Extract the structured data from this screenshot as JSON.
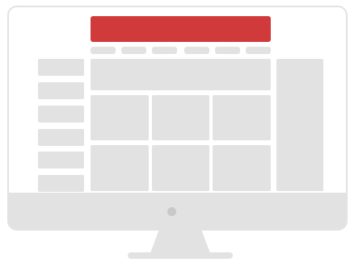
{
  "illustration": {
    "colors": {
      "accent": "#d03a3a",
      "placeholder": "#e2e2e2",
      "frame": "#e2e2e2",
      "power_dot": "#c8c8c8",
      "background": "#ffffff"
    },
    "nav_item_count": 6,
    "sidebar_item_count": 6,
    "content_grid": {
      "rows": 2,
      "columns": 3
    }
  }
}
